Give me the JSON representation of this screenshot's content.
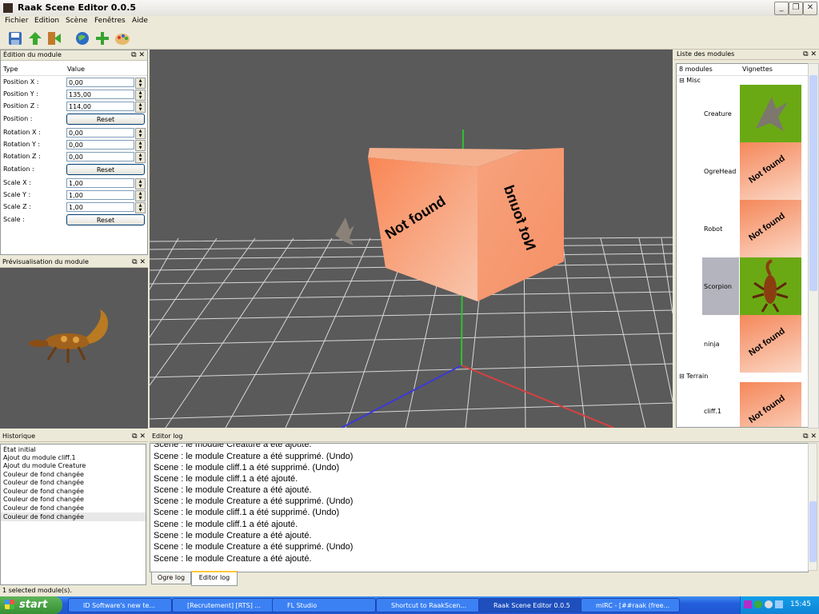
{
  "window": {
    "title": "Raak Scene Editor 0.0.5"
  },
  "menu": [
    "Fichier",
    "Edition",
    "Scène",
    "Fenêtres",
    "Aide"
  ],
  "toolbar_icons": [
    "save-icon",
    "up-arrow-icon",
    "exit-icon",
    "globe-icon",
    "add-icon",
    "palette-icon"
  ],
  "edition_panel": {
    "title": "Édition du module",
    "col_type": "Type",
    "col_value": "Value",
    "rows": [
      {
        "label": "Position X :",
        "value": "0,00"
      },
      {
        "label": "Position Y :",
        "value": "135,00"
      },
      {
        "label": "Position Z :",
        "value": "114,00"
      },
      {
        "label": "Position :",
        "button": "Reset"
      },
      {
        "label": "Rotation X :",
        "value": "0,00"
      },
      {
        "label": "Rotation Y :",
        "value": "0,00"
      },
      {
        "label": "Rotation Z :",
        "value": "0,00"
      },
      {
        "label": "Rotation :",
        "button": "Reset"
      },
      {
        "label": "Scale X :",
        "value": "1,00"
      },
      {
        "label": "Scale Y :",
        "value": "1,00"
      },
      {
        "label": "Scale Z :",
        "value": "1,00"
      },
      {
        "label": "Scale :",
        "button": "Reset"
      }
    ]
  },
  "preview_panel": {
    "title": "Prévisualisation du module"
  },
  "viewport": {
    "cube_front": "Not found",
    "cube_side": "Not found",
    "bg_color": "#5a5a5a",
    "cube_color": "#f7966a"
  },
  "modules_panel": {
    "title": "Liste des modules",
    "count_label": "8 modules",
    "col_thumbs": "Vignettes",
    "groups": [
      {
        "name": "Misc",
        "items": [
          {
            "name": "Creature",
            "thumb": "creature"
          },
          {
            "name": "OgreHead",
            "thumb": "notfound"
          },
          {
            "name": "Robot",
            "thumb": "notfound"
          },
          {
            "name": "Scorpion",
            "thumb": "scorpion",
            "selected": true
          },
          {
            "name": "ninja",
            "thumb": "notfound"
          }
        ]
      },
      {
        "name": "Terrain",
        "items": [
          {
            "name": "cliff.1",
            "thumb": "notfound"
          }
        ]
      }
    ],
    "not_found_text": "Not found"
  },
  "history_panel": {
    "title": "Historique",
    "items": [
      "État initial",
      "Ajout du module cliff.1",
      "Ajout du module Creature",
      "Couleur de fond changée",
      "Couleur de fond changée",
      "Couleur de fond changée",
      "Couleur de fond changée",
      "Couleur de fond changée",
      "Couleur de fond changée"
    ]
  },
  "log_panel": {
    "title": "Editor log",
    "lines": [
      "Scene : le module Creature a été ajouté.",
      "Scene : le module Creature a été supprimé. (Undo)",
      "Scene : le module cliff.1 a été supprimé. (Undo)",
      "Scene : le module cliff.1 a été ajouté.",
      "Scene : le module Creature a été ajouté.",
      "Scene : le module Creature a été supprimé. (Undo)",
      "Scene : le module cliff.1 a été supprimé. (Undo)",
      "Scene : le module cliff.1 a été ajouté.",
      "Scene : le module Creature a été ajouté.",
      "Scene : le module Creature a été supprimé. (Undo)",
      "Scene : le module Creature a été ajouté."
    ],
    "tabs": [
      "Ogre log",
      "Editor log"
    ]
  },
  "status_text": "1 selected module(s).",
  "taskbar": {
    "start": "start",
    "tasks": [
      "ID Software's new te...",
      "[Recrutement] [RTS] ...",
      "FL Studio",
      "Shortcut to RaakScen...",
      "Raak Scene Editor 0.0.5",
      "mIRC - [##raak (free..."
    ],
    "clock": "15:45"
  }
}
